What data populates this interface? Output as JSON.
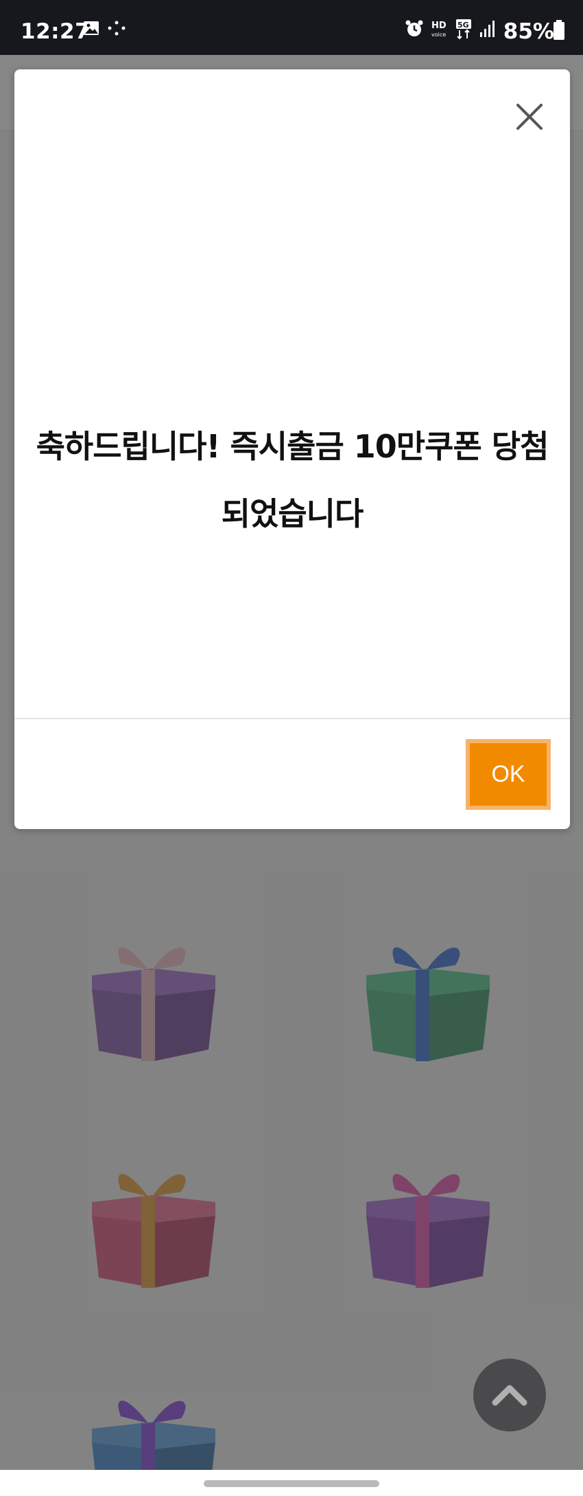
{
  "status_bar": {
    "time": "12:27",
    "battery": "85%",
    "icons": [
      "gallery-icon",
      "dots-icon",
      "alarm-icon",
      "hd-voice-icon",
      "5g-icon",
      "signal-icon",
      "battery-icon"
    ]
  },
  "dialog": {
    "message": "축하드립니다! 즉시출금 10만쿠폰 당첨 되었습니다",
    "ok_label": "OK",
    "close_icon": "close-icon"
  },
  "background": {
    "gifts": [
      {
        "box": "#7a45a8",
        "ribbon": "#f2b7c0"
      },
      {
        "box": "#2eac6e",
        "ribbon": "#1e63d6"
      },
      {
        "box": "#e0406a",
        "ribbon": "#e8951f"
      },
      {
        "box": "#8a3cc0",
        "ribbon": "#e83ca8"
      },
      {
        "box": "#2a7fd0",
        "ribbon": "#7a2fe0"
      }
    ],
    "scroll_top_icon": "chevron-up-icon"
  },
  "colors": {
    "accent": "#f28a00",
    "overlay": "#464646"
  }
}
